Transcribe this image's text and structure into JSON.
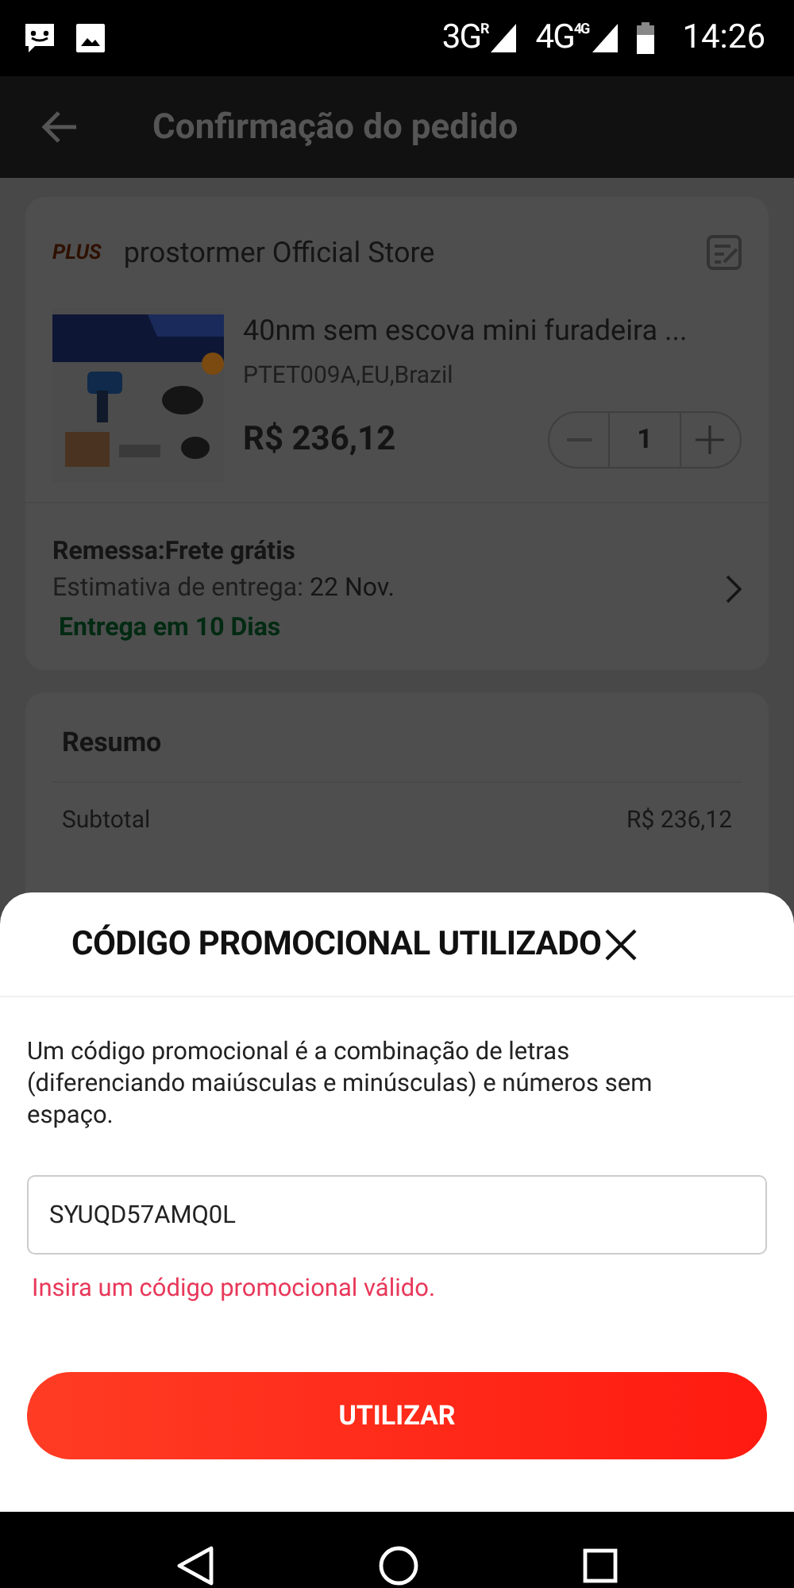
{
  "status_bar": {
    "networks": [
      {
        "label": "3G",
        "badge": "R"
      },
      {
        "label": "4G",
        "badge": "4G"
      }
    ],
    "time": "14:26"
  },
  "header": {
    "title": "Confirmação do pedido"
  },
  "order": {
    "store": {
      "badge": "PLUS",
      "name": "prostormer Official Store"
    },
    "product": {
      "title": "40nm sem escova mini furadeira ...",
      "variant": "PTET009A,EU,Brazil",
      "price": "R$ 236,12",
      "quantity": "1"
    },
    "shipping": {
      "title": "Remessa:Frete grátis",
      "estimate_label": "Estimativa de entrega:",
      "estimate_date": "22 Nov.",
      "delivery": "Entrega em 10 Dias"
    }
  },
  "summary": {
    "title": "Resumo",
    "rows": [
      {
        "label": "Subtotal",
        "value": "R$ 236,12"
      }
    ]
  },
  "sheet": {
    "title": "CÓDIGO PROMOCIONAL UTILIZADO",
    "description": "Um código promocional é a combinação de letras (diferenciando maiúsculas e minúsculas) e números sem espaço.",
    "code": "SYUQD57AMQ0L",
    "error": "Insira um código promocional válido.",
    "button": "UTILIZAR"
  }
}
